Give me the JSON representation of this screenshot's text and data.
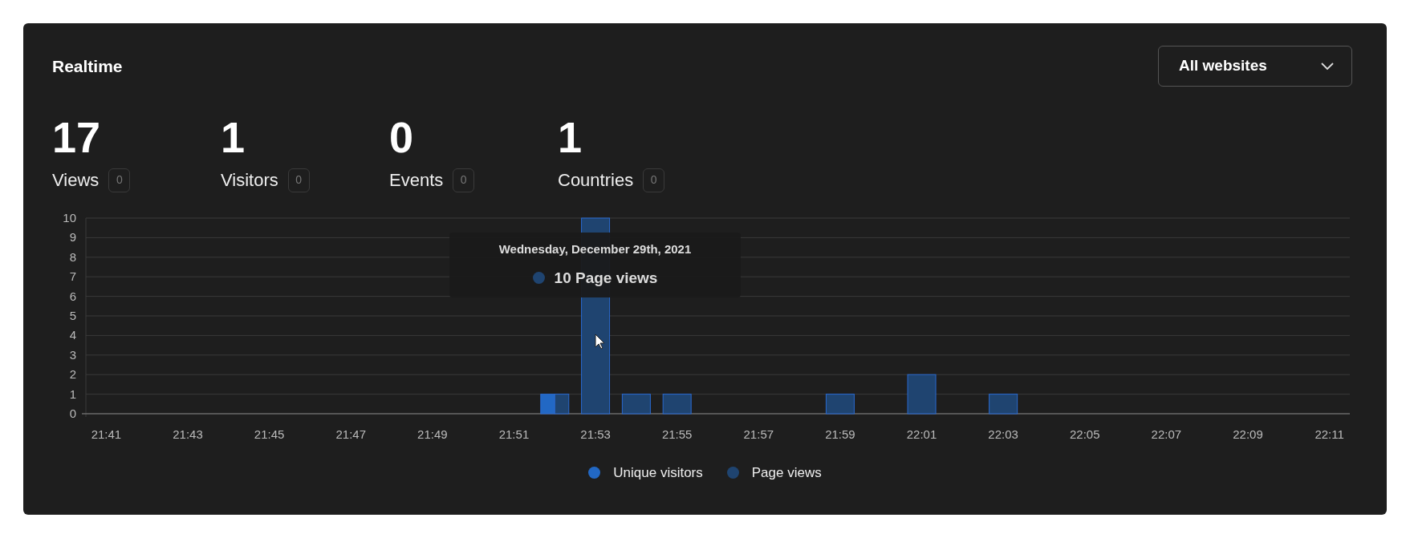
{
  "header": {
    "title": "Realtime",
    "website_select": {
      "value": "All websites"
    }
  },
  "stats": [
    {
      "value": "17",
      "label": "Views",
      "change": "0"
    },
    {
      "value": "1",
      "label": "Visitors",
      "change": "0"
    },
    {
      "value": "0",
      "label": "Events",
      "change": "0"
    },
    {
      "value": "1",
      "label": "Countries",
      "change": "0"
    }
  ],
  "chart": {
    "chart_data": {
      "type": "bar",
      "x": [
        1301,
        1302,
        1303,
        1304,
        1305,
        1306,
        1307,
        1308,
        1309,
        1310,
        1311,
        1312,
        1313,
        1314,
        1315,
        1316,
        1317,
        1318,
        1319,
        1320,
        1321,
        1322,
        1323,
        1324,
        1325,
        1326,
        1327,
        1328,
        1329,
        1330,
        1331
      ],
      "series": [
        {
          "name": "Unique visitors",
          "color": "#2268c4",
          "values": [
            0,
            0,
            0,
            0,
            0,
            0,
            0,
            0,
            0,
            0,
            0,
            1,
            0,
            0,
            0,
            0,
            0,
            0,
            0,
            0,
            0,
            0,
            0,
            0,
            0,
            0,
            0,
            0,
            0,
            0,
            0
          ]
        },
        {
          "name": "Page views",
          "color": "#1f4470",
          "values": [
            0,
            0,
            0,
            0,
            0,
            0,
            0,
            0,
            0,
            0,
            0,
            1,
            10,
            1,
            1,
            0,
            0,
            0,
            1,
            0,
            2,
            0,
            1,
            0,
            0,
            0,
            0,
            0,
            0,
            0,
            0
          ]
        }
      ],
      "ylim": [
        0,
        10
      ],
      "yticks": [
        0,
        1,
        2,
        3,
        4,
        5,
        6,
        7,
        8,
        9,
        10
      ],
      "xticks": [
        {
          "value": 1301,
          "label": "21:41"
        },
        {
          "value": 1303,
          "label": "21:43"
        },
        {
          "value": 1305,
          "label": "21:45"
        },
        {
          "value": 1307,
          "label": "21:47"
        },
        {
          "value": 1309,
          "label": "21:49"
        },
        {
          "value": 1311,
          "label": "21:51"
        },
        {
          "value": 1313,
          "label": "21:53"
        },
        {
          "value": 1315,
          "label": "21:55"
        },
        {
          "value": 1317,
          "label": "21:57"
        },
        {
          "value": 1319,
          "label": "21:59"
        },
        {
          "value": 1321,
          "label": "22:01"
        },
        {
          "value": 1323,
          "label": "22:03"
        },
        {
          "value": 1325,
          "label": "22:05"
        },
        {
          "value": 1327,
          "label": "22:07"
        },
        {
          "value": 1329,
          "label": "22:09"
        },
        {
          "value": 1331,
          "label": "22:11"
        }
      ],
      "xlim": [
        1300.5,
        1331.5
      ],
      "stacked": false,
      "grid": true
    },
    "tooltip": {
      "title": "Wednesday, December 29th, 2021",
      "text": "10 Page views",
      "color": "#1f4470"
    }
  }
}
